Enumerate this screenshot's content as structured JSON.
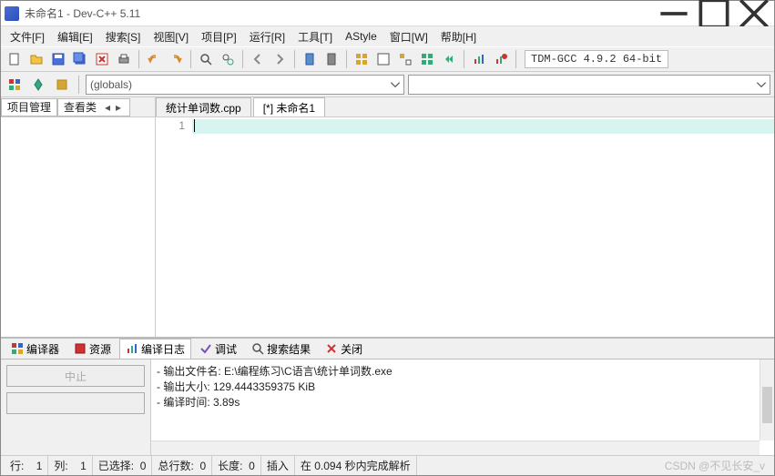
{
  "window": {
    "title": "未命名1 - Dev-C++ 5.11"
  },
  "menu": [
    "文件[F]",
    "编辑[E]",
    "搜索[S]",
    "视图[V]",
    "项目[P]",
    "运行[R]",
    "工具[T]",
    "AStyle",
    "窗口[W]",
    "帮助[H]"
  ],
  "compiler_label": "TDM-GCC 4.9.2 64-bit",
  "scope": "(globals)",
  "left_tabs": {
    "project": "项目管理",
    "classes": "查看类"
  },
  "editor_tabs": [
    "统计单词数.cpp",
    "[*] 未命名1"
  ],
  "editor": {
    "active_tab": 1,
    "line_number": "1"
  },
  "bottom_tabs": [
    "编译器",
    "资源",
    "编译日志",
    "调试",
    "搜索结果",
    "关闭"
  ],
  "bottom_active": 2,
  "abort_btn": "中止",
  "compile_log": "- 输出文件名: E:\\编程练习\\C语言\\统计单词数.exe\n- 输出大小: 129.4443359375 KiB\n- 编译时间: 3.89s",
  "status": {
    "row_label": "行:",
    "row_val": "1",
    "col_label": "列:",
    "col_val": "1",
    "sel_label": "已选择:",
    "sel_val": "0",
    "tot_label": "总行数:",
    "tot_val": "0",
    "len_label": "长度:",
    "len_val": "0",
    "mode": "插入",
    "done": "在 0.094 秒内完成解析",
    "watermark": "CSDN @不见长安_v"
  }
}
